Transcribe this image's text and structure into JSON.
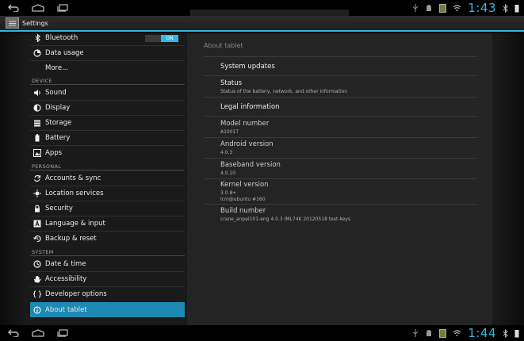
{
  "status_bar": {
    "time_top": "1:43",
    "time_bottom": "1:44"
  },
  "app": {
    "title": "Settings"
  },
  "left": {
    "items": [
      {
        "label": "Bluetooth",
        "toggle": "ON"
      },
      {
        "label": "Data usage"
      },
      {
        "label": "More..."
      }
    ],
    "sections": {
      "device": "DEVICE",
      "personal": "PERSONAL",
      "system": "SYSTEM"
    },
    "device_items": [
      "Sound",
      "Display",
      "Storage",
      "Battery",
      "Apps"
    ],
    "personal_items": [
      "Accounts & sync",
      "Location services",
      "Security",
      "Language & input",
      "Backup & reset"
    ],
    "system_items": [
      "Date & time",
      "Accessibility",
      "Developer options",
      "About tablet"
    ]
  },
  "right": {
    "title": "About tablet",
    "system_updates": "System updates",
    "status": {
      "title": "Status",
      "summary": "Status of the battery, network, and other information"
    },
    "legal": "Legal information",
    "model": {
      "title": "Model number",
      "value": "A1001T"
    },
    "android": {
      "title": "Android version",
      "value": "4.0.3"
    },
    "baseband": {
      "title": "Baseband version",
      "value": "4.0.10"
    },
    "kernel": {
      "title": "Kernel version",
      "value1": "3.0.8+",
      "value2": "lcm@ubuntu #160"
    },
    "build": {
      "title": "Build number",
      "value": "crane_anpei101-eng 4.0.3 IML74K 20120518 test-keys"
    }
  },
  "colors": {
    "accent": "#33b5e5",
    "selected": "#1e89b2"
  }
}
